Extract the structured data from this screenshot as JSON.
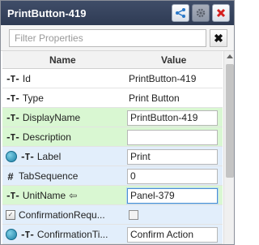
{
  "window": {
    "title": "PrintButton-419"
  },
  "filter": {
    "placeholder": "Filter Properties",
    "clear_label": "✖"
  },
  "grid": {
    "header_name": "Name",
    "header_value": "Value",
    "rows": [
      {
        "label": "Id",
        "value": "PrintButton-419"
      },
      {
        "label": "Type",
        "value": "Print Button"
      },
      {
        "label": "DisplayName",
        "value": "PrintButton-419"
      },
      {
        "label": "Description",
        "value": ""
      },
      {
        "label": "Label",
        "value": "Print"
      },
      {
        "label": "TabSequence",
        "value": "0"
      },
      {
        "label": "UnitName",
        "value": "Panel-379"
      },
      {
        "label": "ConfirmationRequ...",
        "value": ""
      },
      {
        "label": "ConfirmationTi...",
        "value": "Confirm Action"
      }
    ]
  },
  "colors": {
    "titlebar": "#34415b",
    "row_green": "#d9f7d2",
    "row_blue": "#e2eefb",
    "close_red": "#d42020"
  }
}
